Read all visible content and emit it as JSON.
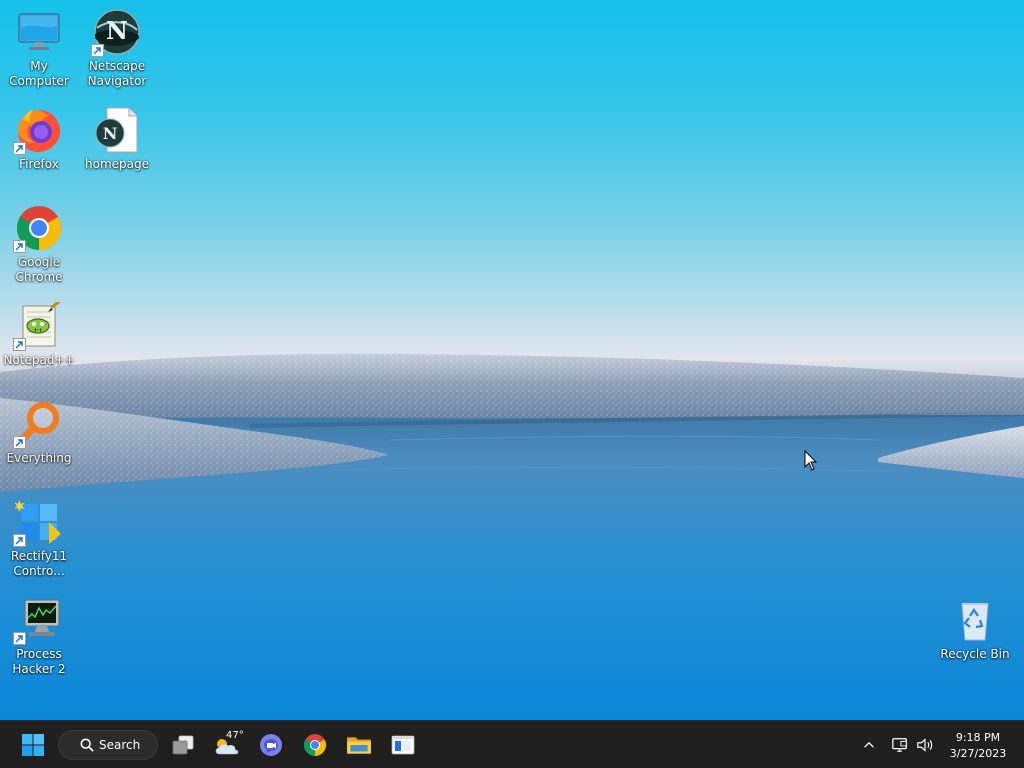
{
  "desktop": {
    "icons": [
      {
        "id": "my-computer",
        "label": "My Computer",
        "icon": "monitor-icon",
        "shortcut": false
      },
      {
        "id": "netscape-navigator",
        "label": "Netscape Navigator",
        "icon": "netscape-icon",
        "shortcut": true
      },
      {
        "id": "firefox",
        "label": "Firefox",
        "icon": "firefox-icon",
        "shortcut": true
      },
      {
        "id": "homepage",
        "label": "homepage",
        "icon": "netscape-document-icon",
        "shortcut": false
      },
      {
        "id": "google-chrome",
        "label": "Google Chrome",
        "icon": "chrome-icon",
        "shortcut": true
      },
      {
        "id": "notepad-plus-plus",
        "label": "Notepad++",
        "icon": "notepad-plus-plus-icon",
        "shortcut": true
      },
      {
        "id": "everything",
        "label": "Everything",
        "icon": "everything-search-icon",
        "shortcut": true
      },
      {
        "id": "rectify11-control",
        "label": "Rectify11 Contro...",
        "icon": "rectify11-icon",
        "shortcut": true
      },
      {
        "id": "process-hacker-2",
        "label": "Process Hacker 2",
        "icon": "process-hacker-icon",
        "shortcut": true
      },
      {
        "id": "recycle-bin",
        "label": "Recycle Bin",
        "icon": "recycle-bin-icon",
        "shortcut": false
      }
    ]
  },
  "taskbar": {
    "start_icon": "windows-start-icon",
    "search_label": "Search",
    "search_icon": "search-icon",
    "weather_temp": "47°",
    "pinned": [
      {
        "name": "task-view",
        "icon": "task-view-icon"
      },
      {
        "name": "widgets-weather",
        "icon": "weather-cloud-icon"
      },
      {
        "name": "teams-chat",
        "icon": "chat-video-icon"
      },
      {
        "name": "google-chrome",
        "icon": "chrome-icon"
      },
      {
        "name": "file-explorer",
        "icon": "folder-icon"
      },
      {
        "name": "app-window",
        "icon": "app-window-icon"
      }
    ],
    "tray": {
      "chevron_icon": "chevron-up-icon",
      "network_icon": "network-icon",
      "volume_icon": "volume-icon",
      "time": "9:18 PM",
      "date": "3/27/2023"
    }
  },
  "colors": {
    "taskbar_bg": "#1f1f1f",
    "windows_blue": "#0078d4",
    "sky_top": "#14c0e9",
    "water": "#0b87d9"
  }
}
